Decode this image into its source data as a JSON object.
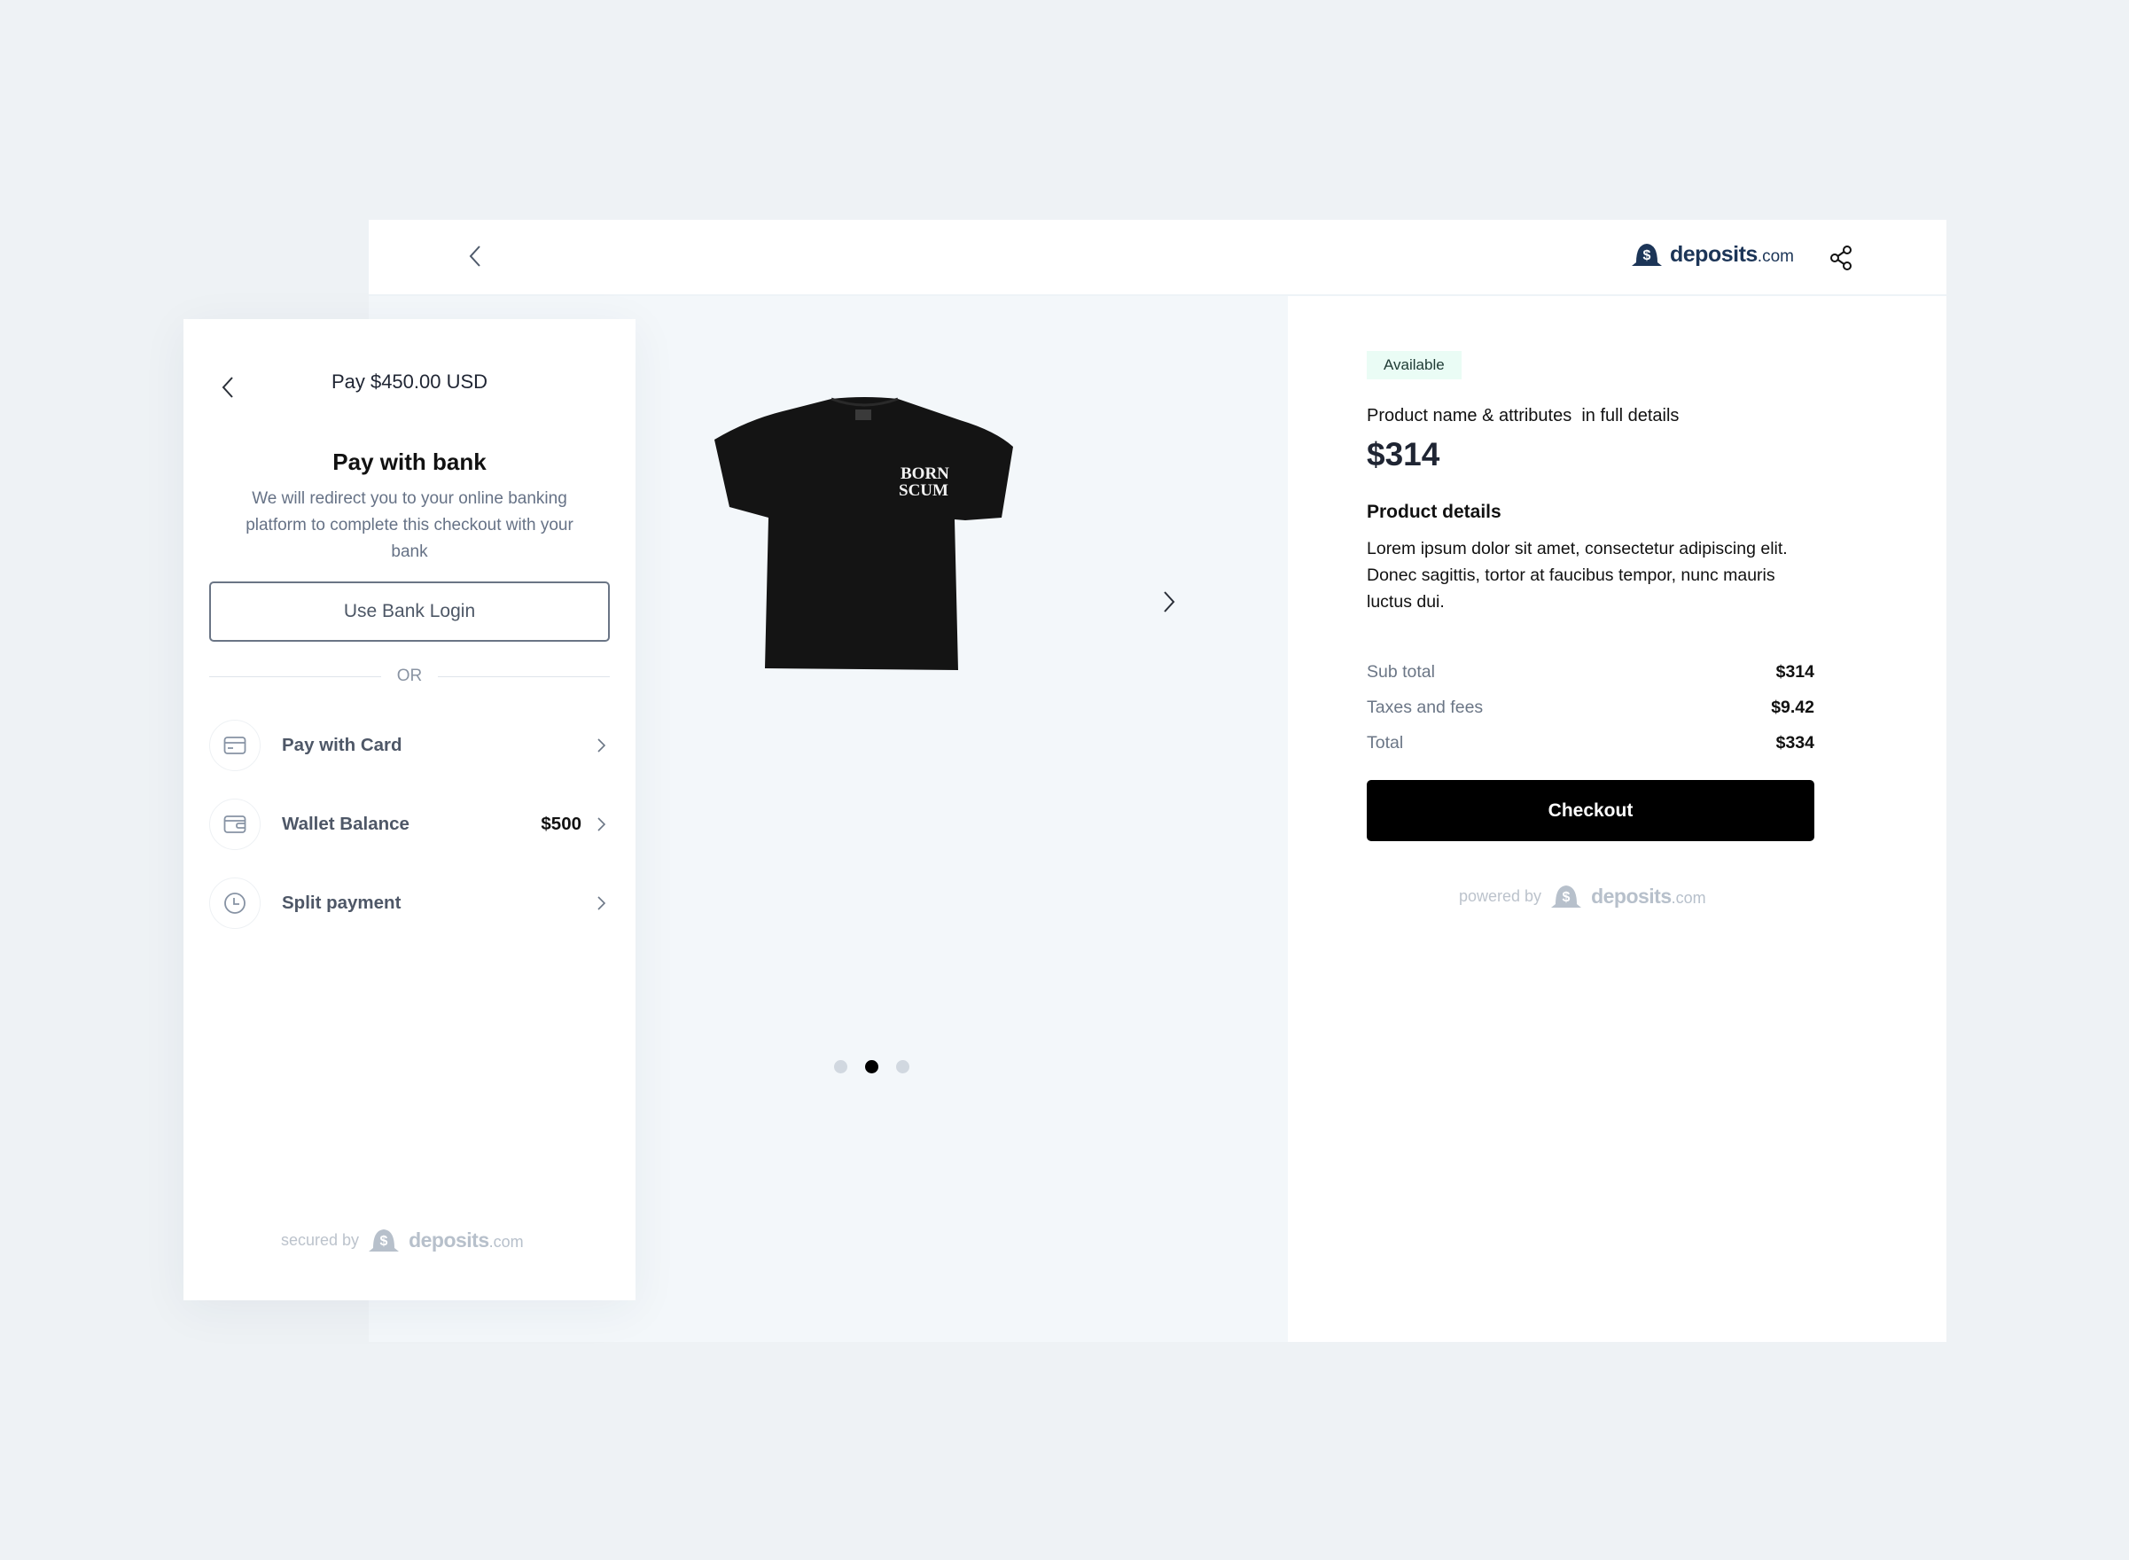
{
  "header": {
    "back_icon": "chevron-left-icon",
    "brand": {
      "name": "deposits",
      "suffix": ".com"
    },
    "share_icon": "share-icon"
  },
  "gallery": {
    "image_alt": "Black t-shirt with BORN SCUM print",
    "print_text_line1": "BORN",
    "print_text_line2": "SCUM",
    "next_icon": "chevron-right-icon",
    "total_slides": 3,
    "active_slide": 2
  },
  "product": {
    "status_badge": "Available",
    "name": "Product name & attributes  in full details",
    "price": "$314",
    "details_title": "Product details",
    "details_text": "Lorem ipsum dolor sit amet, consectetur adipiscing elit. Donec sagittis, tortor at faucibus tempor, nunc mauris luctus dui.",
    "summary": [
      {
        "label": "Sub total",
        "value": "$314"
      },
      {
        "label": "Taxes and fees",
        "value": "$9.42"
      },
      {
        "label": "Total",
        "value": "$334"
      }
    ],
    "checkout_label": "Checkout",
    "powered_by_label": "powered by",
    "powered_brand": {
      "name": "deposits",
      "suffix": ".com"
    }
  },
  "payment_panel": {
    "title": "Pay $450.00 USD",
    "heading": "Pay with bank",
    "description": "We will redirect you to your online banking platform to complete this checkout with your bank",
    "bank_login_label": "Use Bank Login",
    "divider_label": "OR",
    "options": [
      {
        "icon": "credit-card-icon",
        "label": "Pay with Card",
        "value": ""
      },
      {
        "icon": "wallet-icon",
        "label": "Wallet Balance",
        "value": "$500"
      },
      {
        "icon": "clock-icon",
        "label": "Split payment",
        "value": ""
      }
    ],
    "secured_by_label": "secured by",
    "secured_brand": {
      "name": "deposits",
      "suffix": ".com"
    }
  },
  "colors": {
    "brand_navy": "#1c3557",
    "page_bg": "#eef2f5",
    "gallery_bg": "#f3f7fa",
    "badge_bg": "#eafcf5",
    "checkout_bg": "#000000",
    "muted_text": "#667286"
  }
}
